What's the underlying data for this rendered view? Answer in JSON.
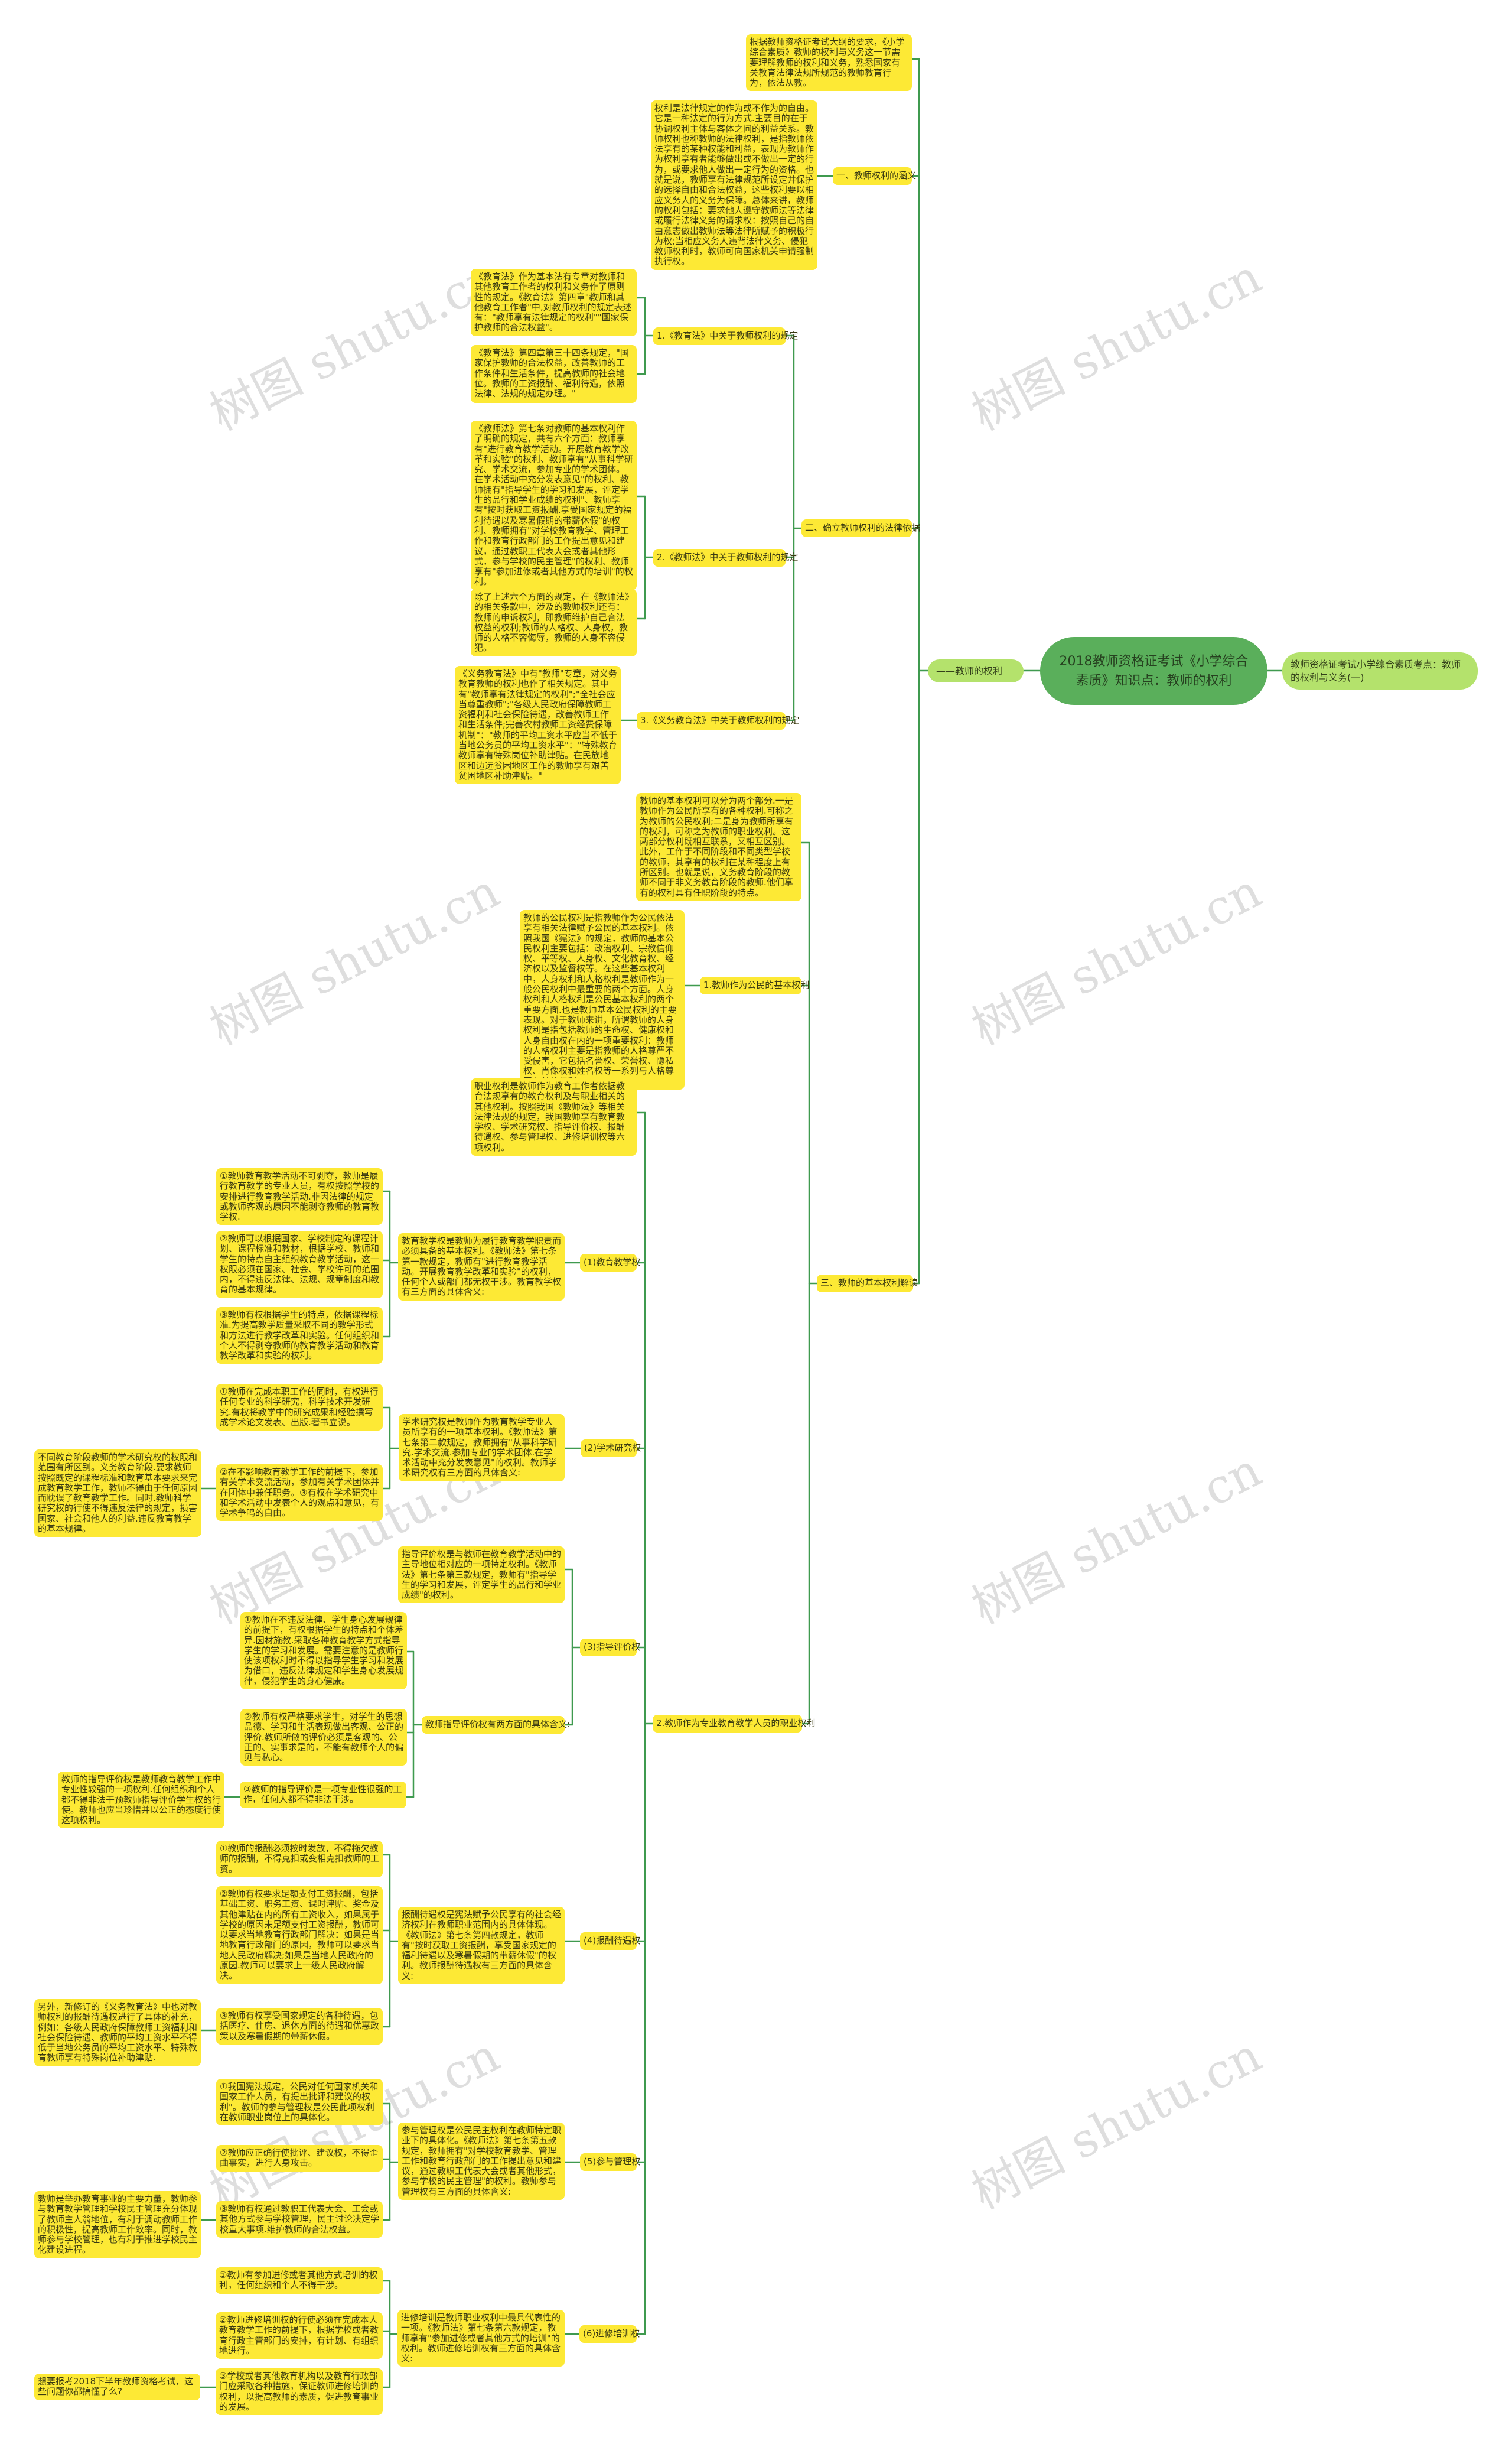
{
  "colors": {
    "node": "#fde935",
    "root": "#5aaf5b",
    "branch": "#b4e26c",
    "line": "#3f9a4f"
  },
  "watermark": "树图 shutu.cn",
  "root": "2018教师资格证考试《小学综合素质》知识点：教师的权利",
  "left_child": "——教师的权利",
  "right_child": "教师资格证考试小学综合素质考点：教师的权利与义务(一)",
  "intro": "根据教师资格证考试大纲的要求，《小学综合素质》教师的权利与义务这一节需要理解教师的权利和义务，熟悉国家有关教育法律法规所规范的教师教育行为，依法从教。",
  "s1": {
    "label": "一、教师权利的涵义",
    "desc": "权利是法律规定的作为或不作为的自由。它是一种法定的行为方式.主要目的在于协调权利主体与客体之间的利益关系。教师权利也称教师的法律权利，是指教师依法享有的某种权能和利益，表现为教师作为权利享有者能够做出或不做出一定的行为，或要求他人做出一定行为的资格。也就是说，教师享有法律规范所设定并保护的选择自由和合法权益，这些权利要以相应义务人的义务为保障。总体来讲，教师的权利包括：要求他人遵守教师法等法律或履行法律义务的请求权：按照自己的自由意志做出教师法等法律所赋予的积极行为权;当相应义务人违背法律义务、侵犯教师权利时，教师可向国家机关申请强制执行权。"
  },
  "s2": {
    "label": "二、确立教师权利的法律依据",
    "a_label": "1.《教育法》中关于教师权利的规定",
    "a1": "《教育法》作为基本法有专章对教师和其他教育工作者的权利和义务作了原则性的规定。《教育法》第四章\"教师和其他教育工作者\"中,对教师权利的规定表述有：\"教师享有法律规定的权利\"\"国家保护教师的合法权益\"。",
    "a2": "《教育法》第四章第三十四条规定，\"国家保护教师的合法权益，改善教师的工作条件和生活条件，提高教师的社会地位。教师的工资报酬、福利待遇，依照法律、法规的规定办理。\"",
    "b_label": "2.《教师法》中关于教师权利的规定",
    "b1": "《教师法》第七条对教师的基本权利作了明确的规定，共有六个方面：教师享有\"进行教育教学活动。开展教育教学改革和实验\"的权利、教师享有\"从事科学研究、学术交流，参加专业的学术团体。在学术活动中充分发表意见\"的权利、教师拥有\"指导学生的学习和发展，评定学生的品行和学业成绩的权利\"、教师享有\"按时获取工资报酬.享受国家规定的福利待遇以及寒暑假期的带薪休假\"的权利、教师拥有\"对学校教育教学、管理工作和教育行政部门的工作提出意见和建议，通过教职工代表大会或者其他形式，参与学校的民主管理\"的权利、教师享有\"参加进修或者其他方式的培训\"的权利。",
    "b2": "除了上述六个方面的规定，在《教师法》的相关条款中，涉及的教师权利还有：教师的申诉权利，即教师维护自己合法权益的权利;教师的人格权、人身权，教师的人格不容侮辱，教师的人身不容侵犯。",
    "c_label": "3.《义务教育法》中关于教师权利的规定",
    "c1": "《义务教育法》中有\"教师\"专章，对义务教育教师的权利也作了相关规定。其中有\"教师享有法律规定的权利\";\"全社会应当尊重教师\";\"各级人民政府保障教师工资福利和社会保险待遇，改善教师工作和生活条件;完善农村教师工资经费保障机制\"：\"教师的平均工资水平应当不低于当地公务员的平均工资水平\"：\"特殊教育教师享有特殊岗位补助津贴。在民族地区和边远贫困地区工作的教师享有艰苦贫困地区补助津贴。\""
  },
  "s3": {
    "label": "三、教师的基本权利解读",
    "intro": "教师的基本权利可以分为两个部分.一是教师作为公民所享有的各种权利.可称之为教师的公民权利;二是身为教师所享有的权利，可称之为教师的职业权利。这两部分权利既相互联系，又相互区别。此外，工作于不同阶段和不同类型学校的教师，其享有的权利在某种程度上有所区别。也就是说，义务教育阶段的教师不同于非义务教育阶段的教师.他们享有的权利具有任职阶段的特点。",
    "a_label": "1.教师作为公民的基本权利",
    "a1": "教师的公民权利是指教师作为公民依法享有相关法律赋予公民的基本权利。依照我国《宪法》的规定，教师的基本公民权利主要包括：政治权利、宗教信仰权、平等权、人身权、文化教育权、经济权以及监督权等。在这些基本权利中，人身权利和人格权利是教师作为一般公民权利中最重要的两个方面。人身权利和人格权利是公民基本权利的两个重要方面.也是教师基本公民权利的主要表现。对于教师来讲，所谓教师的人身权利是指包括教师的生命权、健康权和人身自由权在内的一项重要权利：教师的人格权利主要是指教师的人格尊严不受侵害，它包括名誉权、荣誉权、隐私权、肖像权和姓名权等一系列与人格尊严有关的权利。",
    "b_label": "2.教师作为专业教育教学人员的职业权利",
    "b_intro": "职业权利是教师作为教育工作者依据教育法规享有的教育权利及与职业相关的其他权利。按照我国《教师法》等相关法律法规的规定，我国教师享有教育教学权、学术研究权、指导评价权、报酬待遇权、参与管理权、进修培训权等六项权利。"
  },
  "rights": {
    "r1": {
      "label": "(1)教育教学权",
      "desc": "教育教学权是教师为履行教育教学职责而必须具备的基本权利。《教师法》第七条第一款规定，教师有\"进行教育教学活动。开展教育教学改革和实验\"的权利，任何个人或部门都无权干涉。教育教学权有三方面的具体含义:",
      "items": [
        "①教师教育教学活动不可剥夺，教师是履行教育教学的专业人员，有权按照学校的安排进行教育教学活动.非因法律的规定或教师客观的原因不能剥夺教师的教育教学权.",
        "②教师可以根据国家、学校制定的课程计划、课程标准和教材，根据学校、教师和学生的特点自主组织教育教学活动，这一权限必须在国家、社会、学校许可的范围内，不得违反法律、法规、规章制度和教育的基本规律。",
        "③教师有权根据学生的特点，依据课程标准.为提高教学质量采取不同的教学形式和方法进行教学改革和实验。任何组织和个人不得剥夺教师的教育教学活动和教育教学改革和实验的权利。"
      ]
    },
    "r2": {
      "label": "(2)学术研究权",
      "desc": "学术研究权是教师作为教育教学专业人员所享有的一项基本权利。《教师法》第七条第二款规定，教师拥有\"从事科学研究.学术交流.参加专业的学术团体.在学术活动中充分发表意见\"的权利。教师学术研究权有三方面的具体含义:",
      "items": [
        "①教师在完成本职工作的同时，有权进行任何专业的科学研究，科学技术开发研究.有权将教学中的研究成果和经验撰写成学术论文发表、出版.著书立说。",
        "②在不影响教育教学工作的前提下，参加有关学术交流活动，参加有关学术团体并在团体中兼任职务。③有权在学术研究中和学术活动中发表个人的观点和意见，有学术争鸣的自由。"
      ],
      "note": "不同教育阶段教师的学术研究权的权限和范围有所区别。义务教育阶段.要求教师按照既定的课程标准和教育基本要求来完成教育教学工作，教师不得由于任何原因而耽误了教育教学工作。同时.教师科学研究权的行使不得违反法律的规定，损害国家、社会和他人的利益.违反教育教学的基本规律。"
    },
    "r3": {
      "label": "(3)指导评价权",
      "desc": "指导评价权是与教师在教育教学活动中的主导地位相对应的一项特定权利。《教师法》第七条第三款规定，教师有\"指导学生的学习和发展，评定学生的品行和学业成绩\"的权利。",
      "sub": "教师指导评价权有两方面的具体含义:",
      "items": [
        "①教师在不违反法律、学生身心发展规律的前提下，有权根据学生的特点和个体差异.因材施教.采取各种教育教学方式指导学生的学习和发展。需要注意的是教师行使该项权利时不得以指导学生学习和发展为借口，违反法律规定和学生身心发展规律，侵犯学生的身心健康。",
        "②教师有权严格要求学生，对学生的思想品德、学习和生活表现做出客观、公正的评价.教师所做的评价必须是客观的、公正的、实事求是的，不能有教师个人的偏见与私心。",
        "③教师的指导评价是一项专业性很强的工作，任何人都不得非法干涉。"
      ],
      "note": "教师的指导评价权是教师教育教学工作中专业性较强的一项权利.任何组织和个人都不得非法干预教师指导评价学生权的行使。教师也应当珍惜并以公正的态度行使这项权利。"
    },
    "r4": {
      "label": "(4)报酬待遇权",
      "desc": "报酬待遇权是宪法赋予公民享有的社会经济权利在教师职业范围内的具体体现。《教师法》第七条第四款规定，教师有\"按时获取工资报酬，享受国家规定的福利待遇以及寒暑假期的带薪休假\"的权利。教师报酬待遇权有三方面的具体含义:",
      "items": [
        "①教师的报酬必须按时发放，不得拖欠教师的报酬，不得克扣或变相克扣教师的工资。",
        "②教师有权要求足额支付工资报酬，包括基础工资、职务工资、课时津贴、奖金及其他津贴在内的所有工资收入，如果属于学校的原因未足额支付工资报酬，教师可以要求当地教育行政部门解决：如果是当地教育行政部门的原因，教师可以要求当地人民政府解决;如果是当地人民政府的原因.教师可以要求上一级人民政府解 决。",
        "③教师有权享受国家规定的各种待遇，包括医疗、住房、退休方面的待遇和优惠政策以及寒暑假期的带薪休假。"
      ],
      "note": "另外，新修订的《义务教育法》中也对教师权利的报酬待遇权进行了具体的补充，例如：各级人民政府保障教师工资福利和社会保险待遇、教师的平均工资水平不得低于当地公务员的平均工资水平、特殊教育教师享有特殊岗位补助津贴."
    },
    "r5": {
      "label": "(5)参与管理权",
      "desc": "参与管理权是公民民主权利在教师特定职业下的具体化。《教师法》第七条第五款规定，教师拥有\"对学校教育教学、管理工作和教育行政部门的工作提出意见和建议，通过教职工代表大会或者其他形式，参与学校的民主管理\"的权利。教师参与管理权有三方面的具体含义:",
      "items": [
        "①我国宪法规定，公民对任何国家机关和国家工作人员，有提出批评和建议的权利\"。教师的参与管理权是公民此项权利在教师职业岗位上的具体化。",
        "②教师应正确行使批评、建议权，不得歪曲事实，进行人身攻击。",
        "③教师有权通过教职工代表大会、工会或其他方式参与学校管理，民主讨论决定学校重大事项.维护教师的合法权益。"
      ],
      "note": "教师是举办教育事业的主要力量，教师参与教育教学管理和学校民主管理充分体现了教师主人翁地位，有利于调动教师工作的积极性，提高教师工作效率。同时，教师参与学校管理，也有利于推进学校民主化建设进程。"
    },
    "r6": {
      "label": "(6)进修培训权",
      "desc": "进修培训是教师职业权利中最具代表性的一项。《教师法》第七条第六款规定，教师享有\"参加进修或者其他方式的培训\"的权利。教师进修培训权有三方面的具体含义:",
      "items": [
        "①教师有参加进修或者其他方式培训的权利，任何组织和个人不得干涉。",
        "②教师进修培训权的行使必须在完成本人教育教学工作的前提下，根据学校或者教育行政主管部门的安排，有计划、有组织地进行。",
        "③学校或者其他教育机构以及教育行政部门应采取各种措施，保证教师进修培训的权利，以提高教师的素质，促进教育事业的发展。"
      ],
      "note": "想要报考2018下半年教师资格考试，这些问题你都搞懂了么?"
    }
  }
}
